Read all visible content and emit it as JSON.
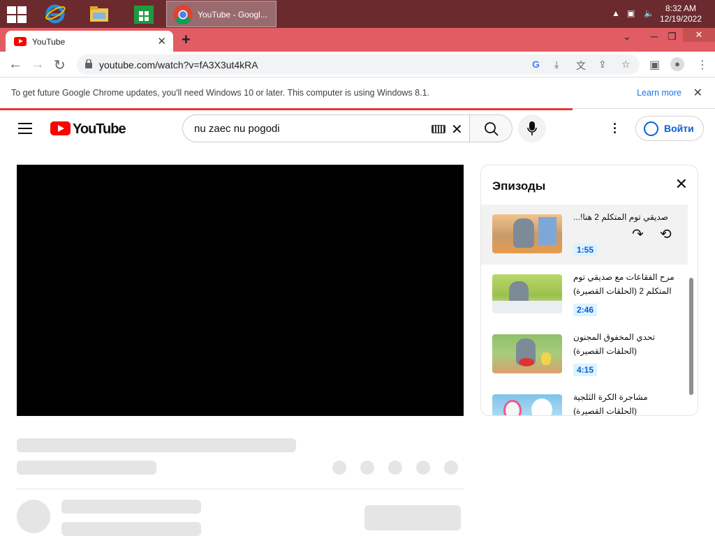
{
  "taskbar": {
    "chrome_task_label": "YouTube - Googl...",
    "time": "8:32 AM",
    "date": "12/19/2022"
  },
  "browser": {
    "tab_title": "YouTube",
    "url": "youtube.com/watch?v=fA3X3ut4kRA",
    "infobar_message": "To get future Google Chrome updates, you'll need Windows 10 or later. This computer is using Windows 8.1.",
    "learn_more": "Learn more"
  },
  "youtube": {
    "logo_text": "YouTube",
    "search_query": "nu zaec nu pogodi",
    "sign_in_label": "Войти"
  },
  "episodes": {
    "title": "Эпизоды",
    "items": [
      {
        "title": "صديقي توم المتكلم 2 هنا!...",
        "duration": "1:55",
        "active": true
      },
      {
        "title": "مرح الفقاعات مع صديقي توم المتكلم 2 (الحلقات القصيرة)",
        "duration": "2:46",
        "active": false
      },
      {
        "title": "تحدي المخفوق المجنون (الحلقات القصيرة)",
        "duration": "4:15",
        "active": false
      },
      {
        "title": "مشاجرة الكرة الثلجية (الحلقات القصيرة)",
        "duration": "",
        "active": false
      }
    ]
  },
  "colors": {
    "taskbar": "#6b2a2e",
    "tabstrip": "#e25c64",
    "accent_blue": "#065fd4",
    "youtube_red": "#ff0000"
  }
}
